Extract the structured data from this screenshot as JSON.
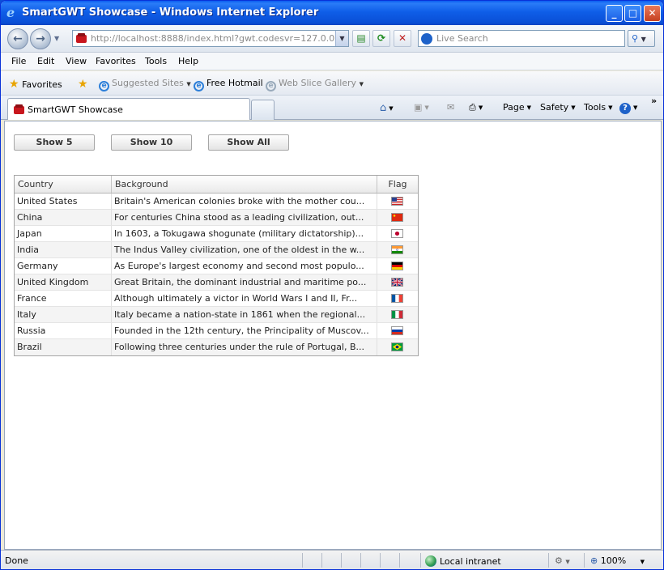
{
  "window": {
    "title": "SmartGWT Showcase - Windows Internet Explorer"
  },
  "address_bar": {
    "url_host": "http://localhost",
    "url_rest": ":8888/index.html?gwt.codesvr=127.0.0.1:999",
    "search_placeholder": "Live Search"
  },
  "menu": {
    "items": [
      "File",
      "Edit",
      "View",
      "Favorites",
      "Tools",
      "Help"
    ]
  },
  "favorites_bar": {
    "favorites_label": "Favorites",
    "suggested_sites": "Suggested Sites",
    "free_hotmail": "Free Hotmail",
    "web_slice_gallery": "Web Slice Gallery"
  },
  "tabs": {
    "active_tab": "SmartGWT Showcase"
  },
  "command_bar": {
    "page": "Page",
    "safety": "Safety",
    "tools": "Tools",
    "overflow": "»"
  },
  "buttons": {
    "show5": "Show 5",
    "show10": "Show 10",
    "show_all": "Show All"
  },
  "grid": {
    "columns": [
      "Country",
      "Background",
      "Flag"
    ],
    "rows": [
      {
        "country": "United States",
        "background": "Britain's American colonies broke with the mother cou...",
        "flag": "us"
      },
      {
        "country": "China",
        "background": "For centuries China stood as a leading civilization, out...",
        "flag": "cn"
      },
      {
        "country": "Japan",
        "background": "In 1603, a Tokugawa shogunate (military dictatorship)...",
        "flag": "jp"
      },
      {
        "country": "India",
        "background": "The Indus Valley civilization, one of the oldest in the w...",
        "flag": "in"
      },
      {
        "country": "Germany",
        "background": "As Europe's largest economy and second most populo...",
        "flag": "de"
      },
      {
        "country": "United Kingdom",
        "background": "Great Britain, the dominant industrial and maritime po...",
        "flag": "gb"
      },
      {
        "country": "France",
        "background": "Although ultimately a victor in World Wars I and II, Fr...",
        "flag": "fr"
      },
      {
        "country": "Italy",
        "background": "Italy became a nation-state in 1861 when the regional...",
        "flag": "it"
      },
      {
        "country": "Russia",
        "background": "Founded in the 12th century, the Principality of Muscov...",
        "flag": "ru"
      },
      {
        "country": "Brazil",
        "background": "Following three centuries under the rule of Portugal, B...",
        "flag": "br"
      }
    ]
  },
  "status_bar": {
    "status": "Done",
    "zone": "Local intranet",
    "zoom": "100%"
  },
  "colors": {
    "titlebar": "#0a4fd6",
    "grid_border": "#a5a5a5",
    "row_alt": "#f4f4f4"
  }
}
